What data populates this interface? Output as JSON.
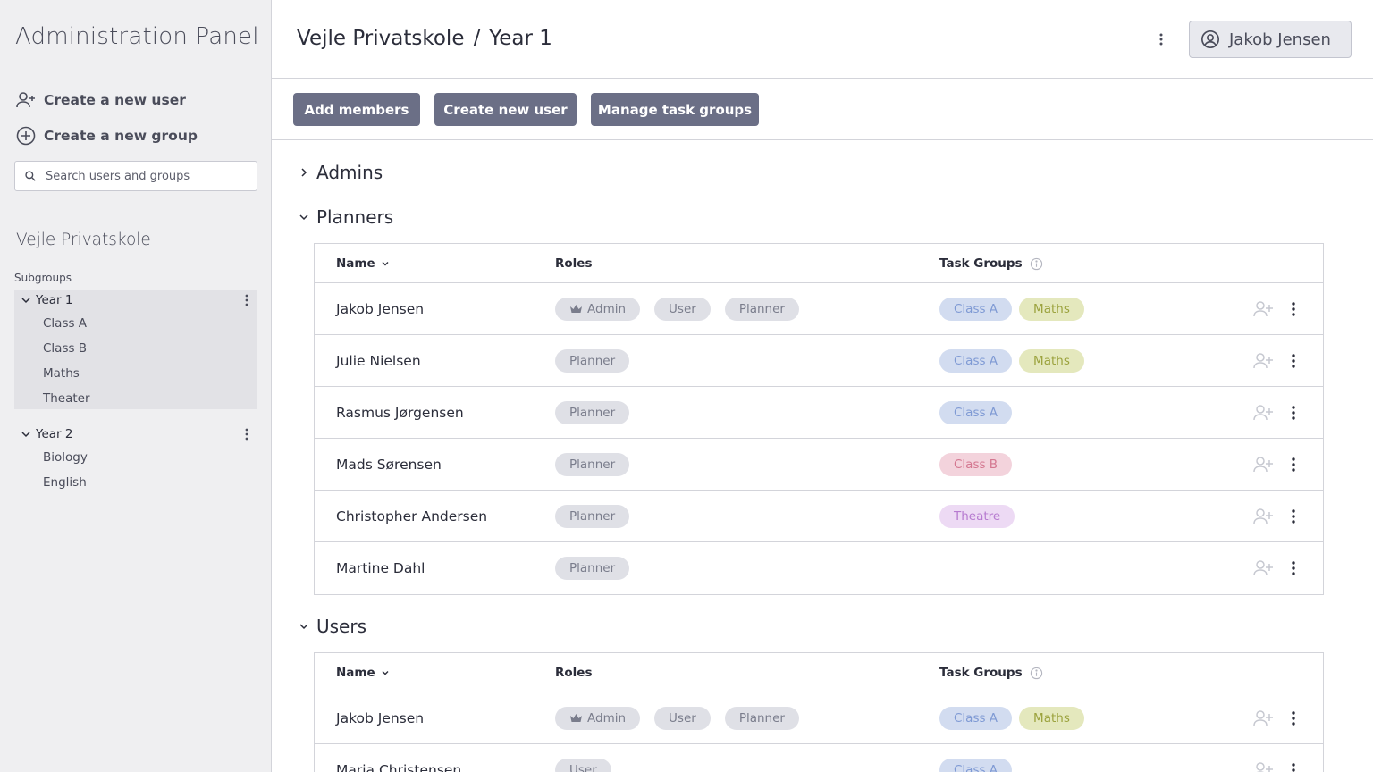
{
  "sidebar": {
    "title": "Administration Panel",
    "create_user": "Create a new user",
    "create_group": "Create a new group",
    "search_placeholder": "Search users and groups",
    "org_name": "Vejle Privatskole",
    "subgroups_label": "Subgroups",
    "groups": [
      {
        "label": "Year 1",
        "items": [
          "Class A",
          "Class B",
          "Maths",
          "Theater"
        ]
      },
      {
        "label": "Year 2",
        "items": [
          "Biology",
          "English"
        ]
      }
    ]
  },
  "header": {
    "breadcrumb": [
      "Vejle Privatskole",
      "/",
      "Year 1"
    ],
    "user_name": "Jakob Jensen"
  },
  "toolbar": {
    "add_members": "Add members",
    "create_user": "Create new user",
    "manage_task_groups": "Manage task groups"
  },
  "columns": {
    "name": "Name",
    "roles": "Roles",
    "task_groups": "Task Groups"
  },
  "sections": {
    "admins": "Admins",
    "planners": "Planners",
    "users": "Users"
  },
  "colors": {
    "class_a": {
      "bg": "#d2dcf0",
      "fg": "#7f9ad4"
    },
    "class_b": {
      "bg": "#f3d3dc",
      "fg": "#d47790"
    },
    "maths": {
      "bg": "#e4e8bd",
      "fg": "#9ba23d"
    },
    "theatre": {
      "bg": "#eddaf4",
      "fg": "#b77bd0"
    }
  },
  "planners": [
    {
      "name": "Jakob Jensen",
      "roles": [
        "Admin",
        "User",
        "Planner"
      ],
      "tasks": [
        "Class A",
        "Maths"
      ]
    },
    {
      "name": "Julie Nielsen",
      "roles": [
        "Planner"
      ],
      "tasks": [
        "Class A",
        "Maths"
      ]
    },
    {
      "name": "Rasmus Jørgensen",
      "roles": [
        "Planner"
      ],
      "tasks": [
        "Class A"
      ]
    },
    {
      "name": "Mads Sørensen",
      "roles": [
        "Planner"
      ],
      "tasks": [
        "Class B"
      ]
    },
    {
      "name": "Christopher Andersen",
      "roles": [
        "Planner"
      ],
      "tasks": [
        "Theatre"
      ]
    },
    {
      "name": "Martine Dahl",
      "roles": [
        "Planner"
      ],
      "tasks": []
    }
  ],
  "users": [
    {
      "name": "Jakob Jensen",
      "roles": [
        "Admin",
        "User",
        "Planner"
      ],
      "tasks": [
        "Class A",
        "Maths"
      ]
    },
    {
      "name": "Maria Christensen",
      "roles": [
        "User"
      ],
      "tasks": [
        "Class A"
      ]
    }
  ]
}
